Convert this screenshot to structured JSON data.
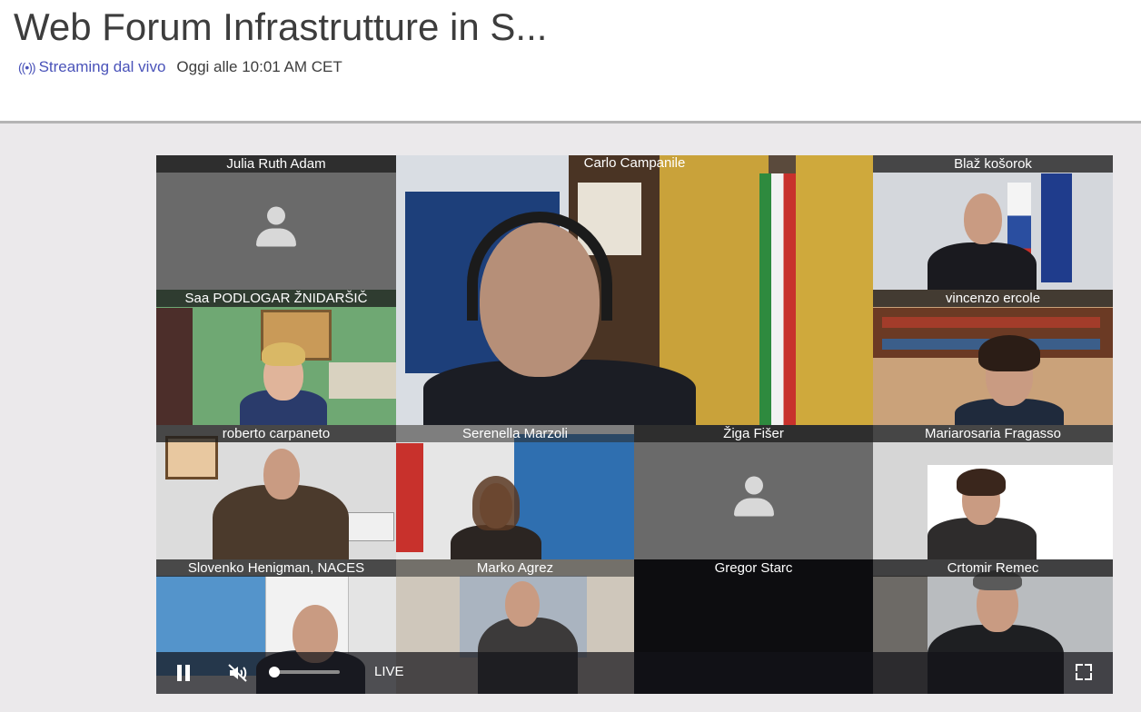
{
  "page": {
    "title": "Web Forum Infrastrutture in S...",
    "live_label": "Streaming dal vivo",
    "live_icon": "broadcast-icon",
    "time": "Oggi alle 10:01 AM CET"
  },
  "participants": {
    "julia": "Julia Ruth Adam",
    "carlo": "Carlo Campanile",
    "blaz": "Blaž košorok",
    "saa": "Saa PODLOGAR ŽNIDARŠIČ",
    "vincenzo": "vincenzo ercole",
    "roberto": "roberto carpaneto",
    "serenella": "Serenella Marzoli",
    "ziga": "Žiga Fišer",
    "mariarosaria": "Mariarosaria Fragasso",
    "slovenko": "Slovenko Henigman, NACES",
    "marko": "Marko Agrez",
    "gregor": "Gregor Starc",
    "crtomir": "Crtomir Remec"
  },
  "player": {
    "live": "LIVE",
    "volume_level": 0.08,
    "muted": true,
    "icons": [
      "pause-icon",
      "muted-speaker-icon",
      "fullscreen-icon"
    ]
  },
  "colors": {
    "accent": "#4a53b9",
    "title": "#3d3d3d"
  }
}
